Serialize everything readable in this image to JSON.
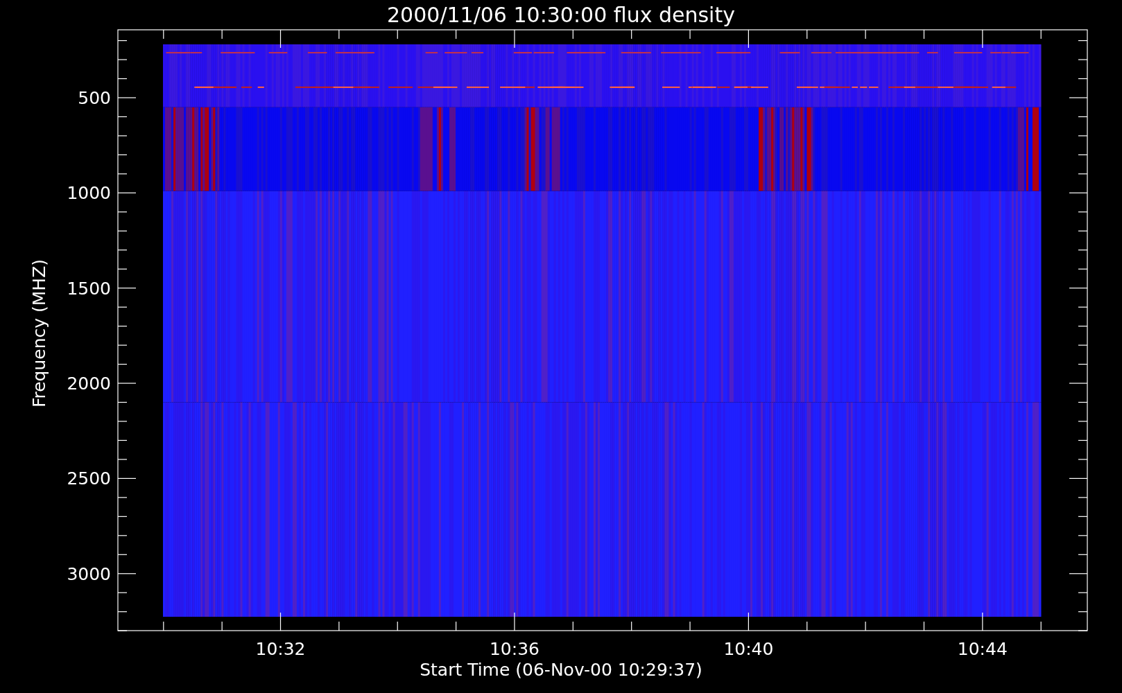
{
  "title": "2000/11/06 10:30:00 flux density",
  "plot": {
    "ylabel": "Frequency (MHZ)",
    "xlabel": "Start Time (06-Nov-00 10:29:37)",
    "y_tick_labels": [
      "500",
      "1000",
      "1500",
      "2000",
      "2500",
      "3000"
    ],
    "x_tick_labels": [
      "10:32",
      "10:36",
      "10:40",
      "10:44"
    ]
  }
}
